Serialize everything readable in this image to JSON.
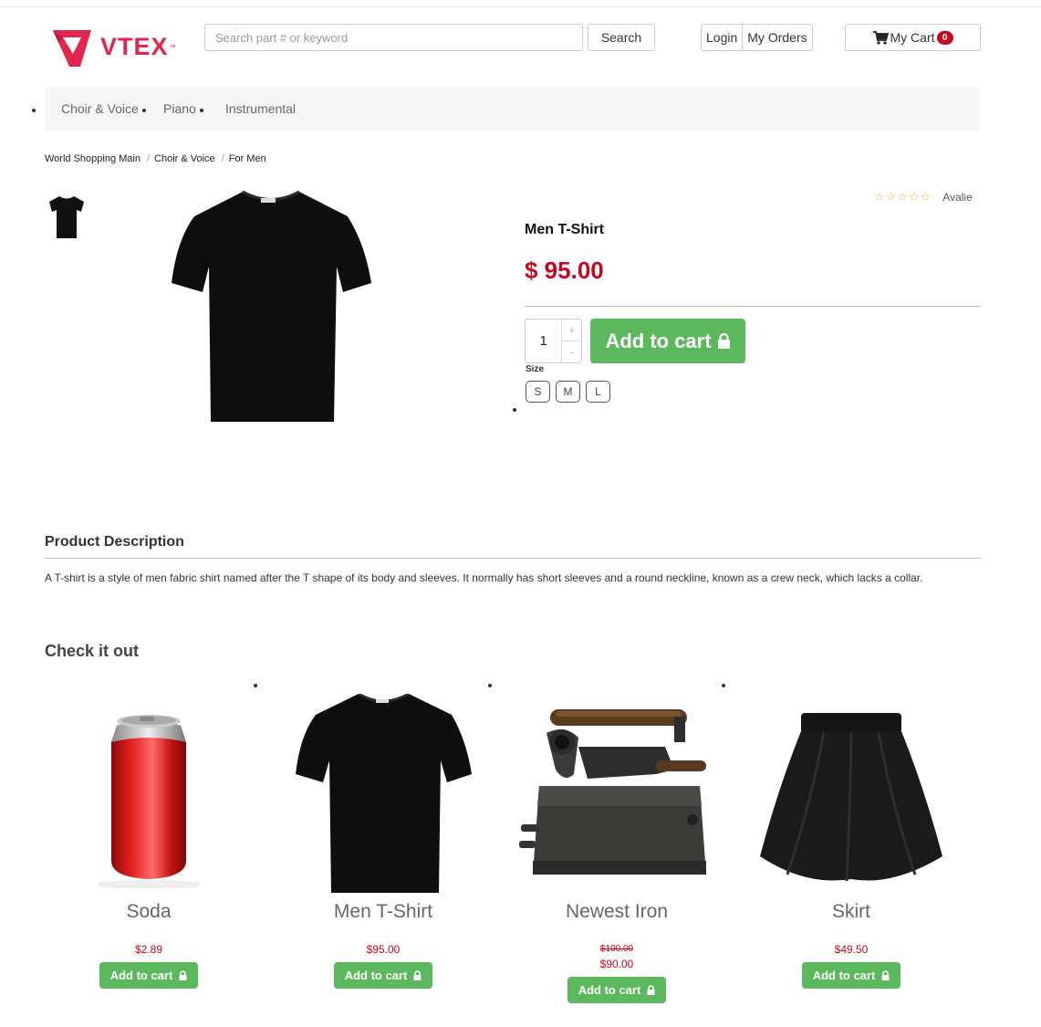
{
  "header": {
    "logo_text": "VTEX",
    "logo_tm": "™",
    "search_placeholder": "Search part # or keyword",
    "search_label": "Search",
    "login_label": "Login",
    "orders_label": "My Orders",
    "cart_label": "My Cart",
    "cart_count": "0",
    "brand_color": "#e3264d"
  },
  "nav": {
    "items": [
      {
        "label": "Choir & Voice"
      },
      {
        "label": "Piano"
      },
      {
        "label": "Instrumental"
      }
    ]
  },
  "breadcrumb": {
    "items": [
      "World Shopping Main",
      "Choir & Voice",
      "For Men"
    ],
    "separator": "/"
  },
  "product": {
    "name": "Men T-Shirt",
    "price": "$ 95.00",
    "rating_stars": "☆☆☆☆☆",
    "rating_author": "Avalie",
    "quantity": "1",
    "qty_plus": "+",
    "qty_minus": "-",
    "add_to_cart": "Add to cart",
    "size_label": "Size",
    "sizes": [
      "S",
      "M",
      "L"
    ],
    "price_color": "#c4081d",
    "button_color": "#5cb85c"
  },
  "description": {
    "title": "Product Description",
    "text": "A T-shirt is a style of men fabric shirt named after the T shape of its body and sleeves. It normally has short sleeves and a round neckline, known as a crew neck, which lacks a collar."
  },
  "related": {
    "title": "Check it out",
    "add_label": "Add to cart",
    "items": [
      {
        "name": "Soda",
        "price": "$2.89",
        "old_price": "",
        "image": "soda-can-icon"
      },
      {
        "name": "Men T-Shirt",
        "price": "$95.00",
        "old_price": "",
        "image": "tshirt-icon"
      },
      {
        "name": "Newest Iron",
        "price": "$90.00",
        "old_price": "$100.00",
        "image": "iron-icon"
      },
      {
        "name": "Skirt",
        "price": "$49.50",
        "old_price": "",
        "image": "skirt-icon"
      }
    ]
  }
}
